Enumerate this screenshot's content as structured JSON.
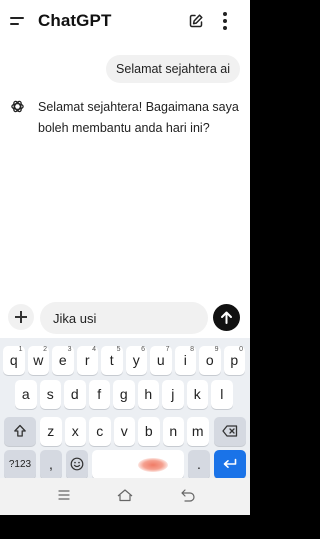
{
  "header": {
    "title": "ChatGPT"
  },
  "chat": {
    "user_message": "Selamat sejahtera ai",
    "assistant_message": "Selamat sejahtera! Bagaimana saya boleh membantu anda hari ini?"
  },
  "composer": {
    "input_value": "Jika usi"
  },
  "keyboard": {
    "row1": [
      {
        "key": "q",
        "alt": "1"
      },
      {
        "key": "w",
        "alt": "2"
      },
      {
        "key": "e",
        "alt": "3"
      },
      {
        "key": "r",
        "alt": "4"
      },
      {
        "key": "t",
        "alt": "5"
      },
      {
        "key": "y",
        "alt": "6"
      },
      {
        "key": "u",
        "alt": "7"
      },
      {
        "key": "i",
        "alt": "8"
      },
      {
        "key": "o",
        "alt": "9"
      },
      {
        "key": "p",
        "alt": "0"
      }
    ],
    "row2": [
      "a",
      "s",
      "d",
      "f",
      "g",
      "h",
      "j",
      "k",
      "l"
    ],
    "row3": [
      "z",
      "x",
      "c",
      "v",
      "b",
      "n",
      "m"
    ],
    "symbols_label": "?123",
    "comma_label": ",",
    "period_label": "."
  },
  "icons": {
    "menu": "menu-icon",
    "edit": "edit-icon",
    "more": "more-vertical-icon",
    "assistant_avatar": "openai-logo-icon",
    "add": "plus-icon",
    "send": "arrow-up-icon",
    "shift": "shift-icon",
    "backspace": "backspace-icon",
    "emoji": "emoji-icon",
    "enter": "enter-icon",
    "nav_recent": "recent-apps-icon",
    "nav_home": "home-icon",
    "nav_back": "back-icon"
  },
  "colors": {
    "accent": "#1a73e8",
    "send_button": "#111111",
    "bubble": "#f1f1f1",
    "keyboard_bg": "#eceff3"
  }
}
